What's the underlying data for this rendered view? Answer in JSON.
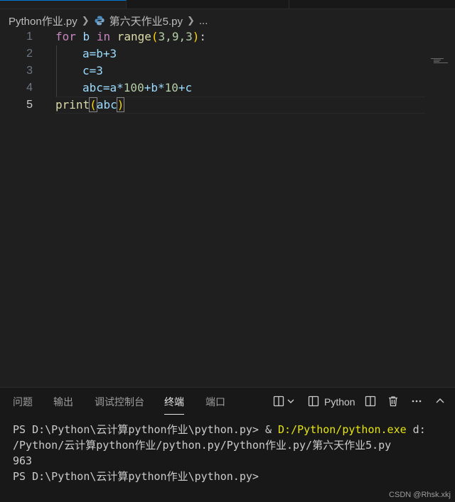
{
  "breadcrumb": {
    "folder": "Python作业.py",
    "file": "第六天作业5.py",
    "ellipsis": "..."
  },
  "editor": {
    "line_numbers": [
      "1",
      "2",
      "3",
      "4",
      "5"
    ],
    "lines": [
      {
        "kw": "for",
        "var": "b",
        "kw2": "in",
        "fn": "range",
        "open": "(",
        "args": "3,9,3",
        "close": ")",
        "end": ":"
      },
      {
        "text": "a=b+3"
      },
      {
        "text": "c=3"
      },
      {
        "pre": "abc=a*",
        "n1": "100",
        "mid": "+b*",
        "n2": "10",
        "post": "+c"
      },
      {
        "fn": "print",
        "open": "(",
        "arg": "abc",
        "close": ")"
      }
    ]
  },
  "panel": {
    "tabs": [
      "问题",
      "输出",
      "调试控制台",
      "终端",
      "端口"
    ],
    "active_tab": "终端",
    "shell_label": "Python",
    "terminal": {
      "line1_prompt": "PS D:\\Python\\云计算python作业\\python.py> & ",
      "line1_exe": "D:/Python/python.exe",
      "line1_rest": " d:",
      "line2": "/Python/云计算python作业/python.py/Python作业.py/第六天作业5.py",
      "line3": "963",
      "line4": "PS D:\\Python\\云计算python作业\\python.py>"
    }
  },
  "watermark": "CSDN @Rhsk.xkj",
  "colors": {
    "background": "#1f1f1f",
    "panel_background": "#181818",
    "keyword": "#569cd6",
    "function": "#dcdcaa",
    "number": "#b5cea8",
    "highlight_path": "#e5e510"
  }
}
